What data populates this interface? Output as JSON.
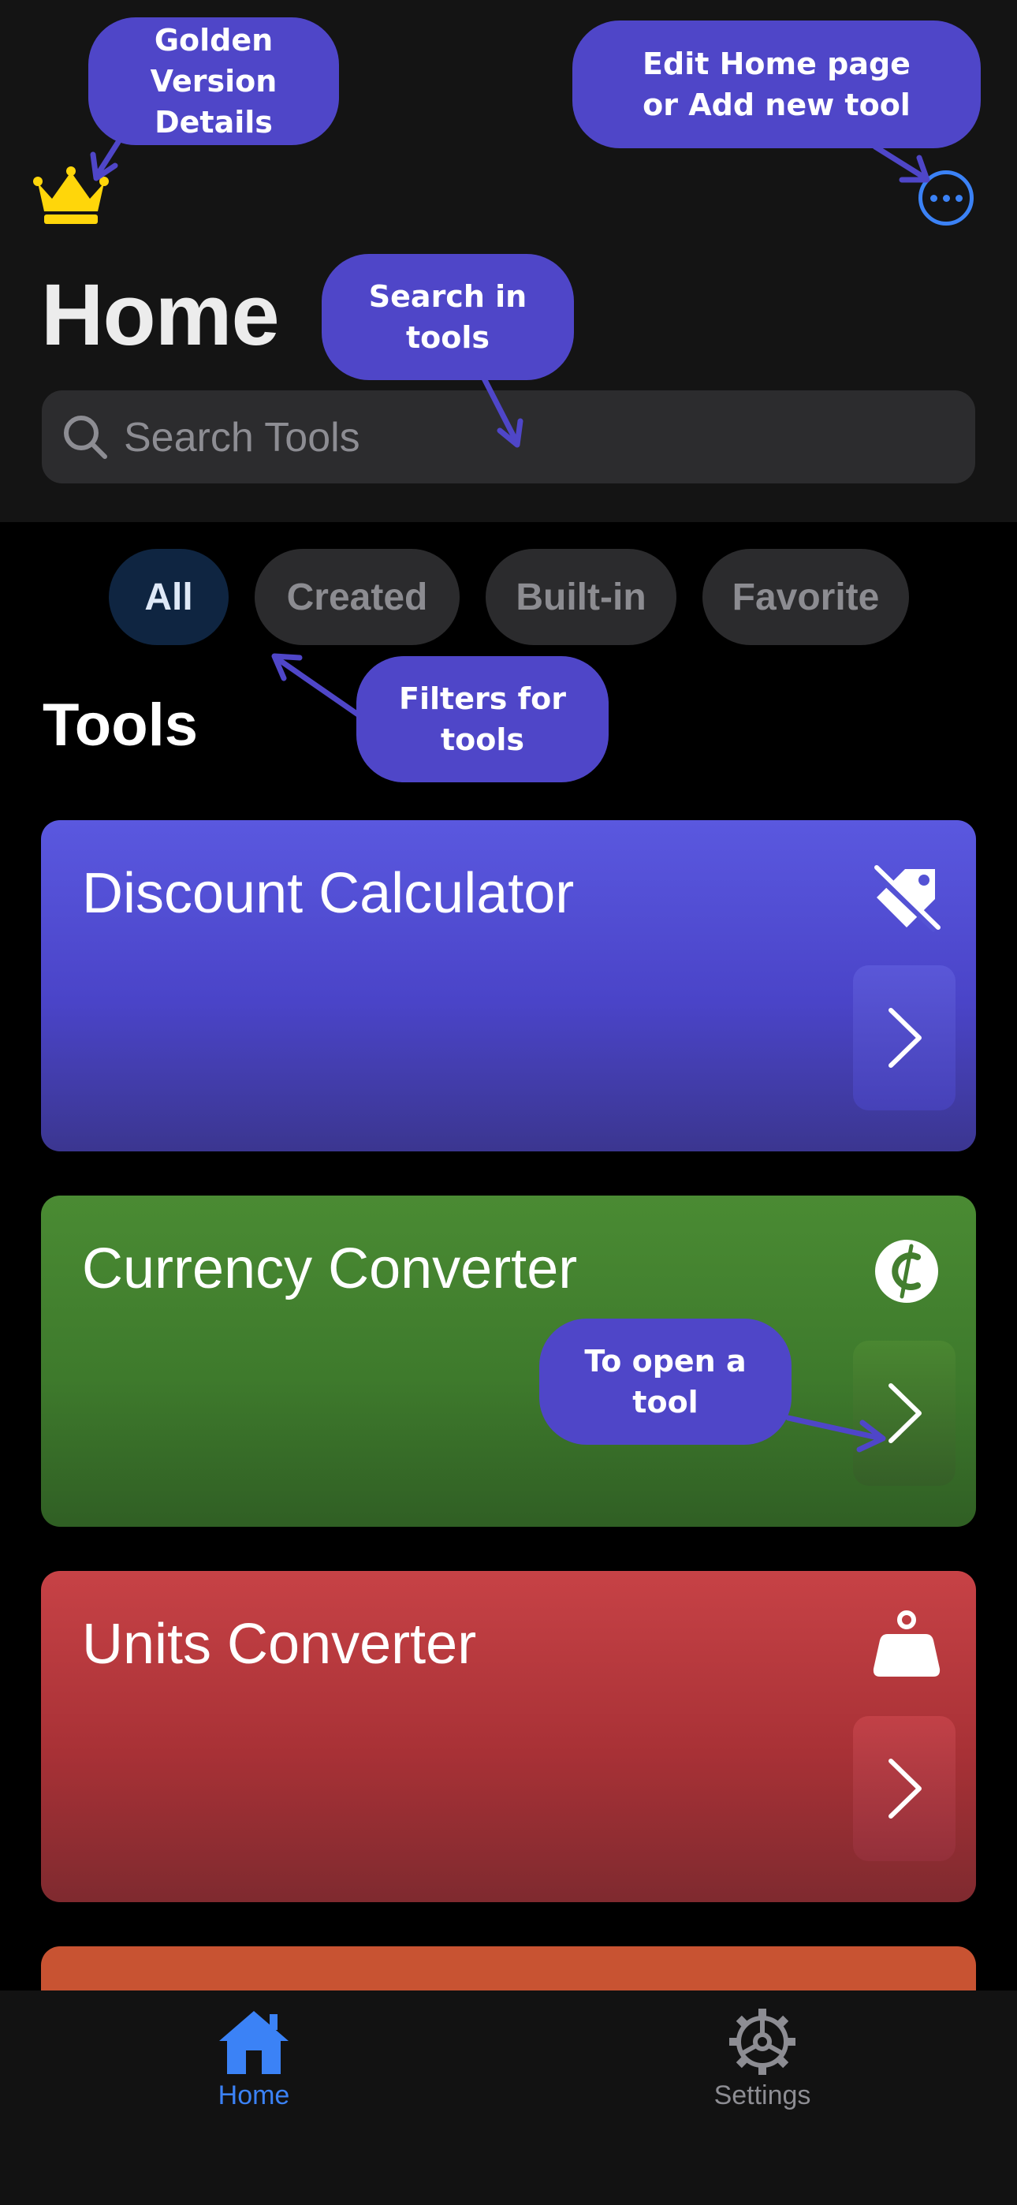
{
  "header": {
    "title": "Home",
    "search_placeholder": "Search Tools"
  },
  "filters": [
    {
      "label": "All",
      "active": true
    },
    {
      "label": "Created",
      "active": false
    },
    {
      "label": "Built-in",
      "active": false
    },
    {
      "label": "Favorite",
      "active": false
    }
  ],
  "section_title": "Tools",
  "tools": [
    {
      "title": "Discount Calculator",
      "icon": "tag-slash-icon",
      "color": "#5552D6"
    },
    {
      "title": "Currency Converter",
      "icon": "cedi-sign-icon",
      "color": "#437E2F"
    },
    {
      "title": "Units Converter",
      "icon": "scale-weight-icon",
      "color": "#B83A3E"
    },
    {
      "title": "",
      "icon": "",
      "color": "#C85332"
    }
  ],
  "tabbar": {
    "home_label": "Home",
    "settings_label": "Settings",
    "active_color": "#3B82F6"
  },
  "callouts": {
    "golden": "Golden Version\nDetails",
    "edit": "Edit Home page\nor Add new tool",
    "search": "Search in tools",
    "filters": "Filters for\ntools",
    "open": "To open a tool"
  },
  "icons": {
    "crown": "crown-icon",
    "more": "ellipsis-circle-icon",
    "search": "magnifying-glass-icon",
    "open": "chevron-right-icon",
    "home": "house-icon",
    "settings": "gear-icon"
  }
}
